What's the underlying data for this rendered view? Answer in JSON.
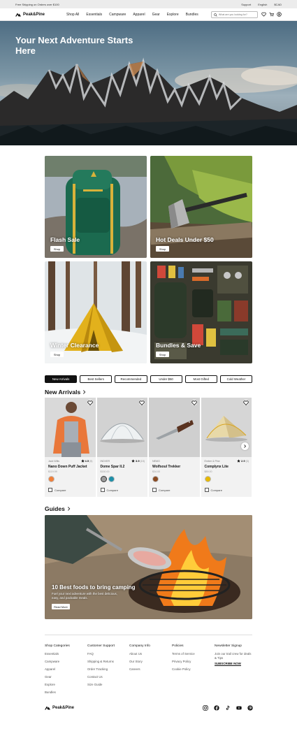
{
  "topbar": {
    "promo": "Free Shipping on Orders over $100",
    "links": [
      "Support",
      "English",
      "$CAD"
    ]
  },
  "nav": {
    "brand": "Peak&Pine",
    "menu": [
      "Shop All",
      "Essentials",
      "Campware",
      "Apparel",
      "Gear",
      "Explore",
      "Bundles"
    ],
    "search_placeholder": "What are you looking for?"
  },
  "hero": {
    "title": "Your Next Adventure Starts Here"
  },
  "tiles": [
    {
      "label": "Flash Sale",
      "button": "Shop"
    },
    {
      "label": "Hot Deals Under $50",
      "button": "Shop"
    },
    {
      "label": "Winter Clearance",
      "button": "Shop"
    },
    {
      "label": "Bundles & Save",
      "button": "Shop"
    }
  ],
  "tabs": [
    "New Arrivals",
    "Best  Sellers",
    "Recommended",
    "Under $50",
    "Most Gifted",
    "Cold Weather"
  ],
  "new_arrivals": {
    "title": "New Arrivals",
    "products": [
      {
        "brand": "Jack Wills",
        "rating": "4.5",
        "count": "(5)",
        "name": "Nano Down Puff Jacket",
        "price": "$119.99",
        "swatches": [
          "#ef7f3a"
        ],
        "compare": "Compare"
      },
      {
        "brand": "INDVER",
        "rating": "3.9",
        "count": "(15)",
        "name": "Dome Spar II.2",
        "price": "$150.00",
        "swatches": [
          "#9c9c9c",
          "#1e8fa8"
        ],
        "compare": "Compare"
      },
      {
        "brand": "NEMO",
        "rating": "",
        "count": "",
        "name": "Wolfsoul Trekker",
        "price": "$34.00",
        "swatches": [
          "#8a4a22"
        ],
        "compare": "Compare"
      },
      {
        "brand": "Ember & Pine",
        "rating": "2.9",
        "count": "(3)",
        "name": "Complynx Lite",
        "price": "$89.00",
        "swatches": [
          "#e6b800"
        ],
        "compare": "Compare"
      }
    ]
  },
  "guides": {
    "title": "Guides",
    "card_title": "10 Best foods to bring camping",
    "card_text": "Fuel your next adventure with the best delicious, easy, and packable meals.",
    "button": "Read More"
  },
  "footer": {
    "columns": [
      {
        "title": "Shop Categories",
        "items": [
          "Essentials",
          "Campware",
          "Apparel",
          "Gear",
          "Explore",
          "Bundles"
        ]
      },
      {
        "title": "Customer Support",
        "items": [
          "FAQ",
          "Shipping & Returns",
          "Order Tracking",
          "Contact Us",
          "Size Guide"
        ]
      },
      {
        "title": "Company Info",
        "items": [
          "About Us",
          "Our Story",
          "Careers"
        ]
      },
      {
        "title": "Policies",
        "items": [
          "Terms of Service",
          "Privacy Policy",
          "Cookie Policy"
        ]
      }
    ],
    "newsletter": {
      "title": "Newsletter Signup",
      "text": "Join our trail crew for deals & Tips",
      "cta": "SUBSCRIBE NOW"
    },
    "brand": "Peak&Pine",
    "social_icons": [
      "instagram-icon",
      "facebook-icon",
      "tiktok-icon",
      "youtube-icon",
      "pinterest-icon"
    ]
  }
}
